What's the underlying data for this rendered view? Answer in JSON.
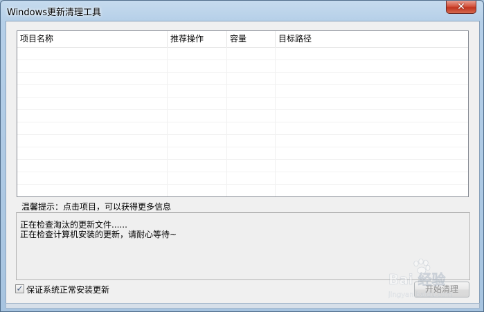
{
  "window": {
    "title": "Windows更新清理工具",
    "close_glyph": "✕"
  },
  "list": {
    "columns": [
      {
        "label": "项目名称"
      },
      {
        "label": "推荐操作"
      },
      {
        "label": "容量"
      },
      {
        "label": "目标路径"
      }
    ]
  },
  "hint": {
    "text": "温馨提示：点击项目，可以获得更多信息"
  },
  "log": {
    "lines": [
      "正在检查淘汰的更新文件......",
      "正在检查计算机安装的更新，请耐心等待~"
    ]
  },
  "options": {
    "keep_updates_label": "保证系统正常安装更新",
    "keep_updates_checked": true,
    "check_glyph": "✓"
  },
  "actions": {
    "start_label": "开始清理"
  },
  "watermark": {
    "text": "Bai 经验",
    "url_text": "jingyan.baidu.com"
  }
}
